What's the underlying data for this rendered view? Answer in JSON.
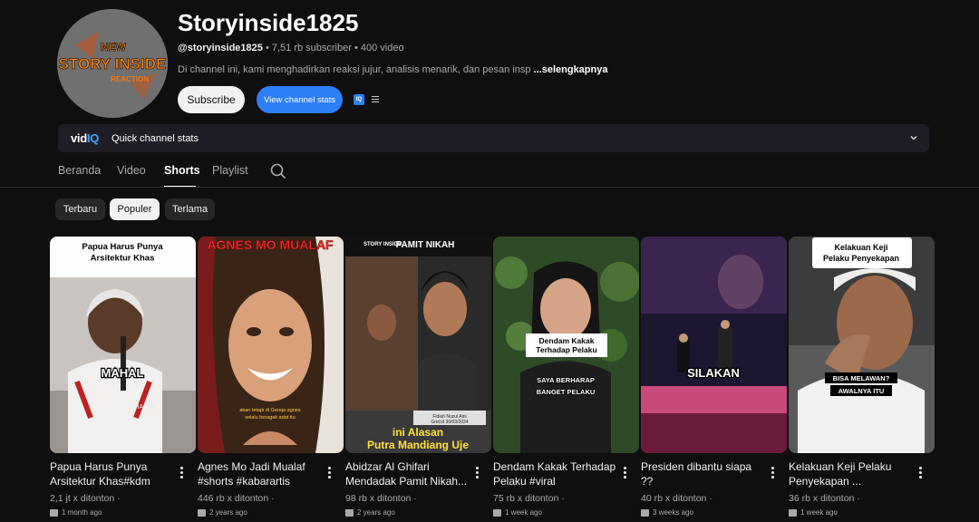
{
  "channel": {
    "title": "Storyinside1825",
    "handle": "@storyinside1825",
    "stats": "• 7,51 rb subscriber • 400 video",
    "description": "Di channel ini, kami menghadirkan reaksi jujur, analisis menarik, dan pesan insp",
    "more_label": "...selengkapnya",
    "avatar_text": [
      "NEW",
      "STORY INSIDE",
      "REACTION"
    ]
  },
  "buttons": {
    "subscribe": "Subscribe",
    "channel_stats": "View channel stats",
    "vidiq_badge": "IQ"
  },
  "vidiq_bar": {
    "logo_vid": "vid",
    "logo_iq": "IQ",
    "label": "Quick channel stats"
  },
  "tabs": [
    {
      "label": "Beranda"
    },
    {
      "label": "Video"
    },
    {
      "label": "Shorts"
    },
    {
      "label": "Playlist"
    }
  ],
  "active_tab": "Shorts",
  "chips": [
    {
      "label": "Terbaru"
    },
    {
      "label": "Populer"
    },
    {
      "label": "Terlama"
    }
  ],
  "active_chip": "Populer",
  "shorts": [
    {
      "title": "Papua Harus Punya Arsitektur Khas#kdm",
      "views": "2,1 jt x ditonton ·",
      "age": "1 month ago",
      "thumb_top_text": "Papua Harus Punya Arsitektur Khas",
      "thumb_overlay": "MAHAL",
      "thumb_watermark": "CHANNEL"
    },
    {
      "title": "Agnes Mo Jadi Mualaf #shorts #kabarartis",
      "views": "446 rb x ditonton ·",
      "age": "2 years ago",
      "thumb_top_text": "AGNES MO MUALAF",
      "thumb_caption": "akan tetapi di Gereja agnes selalu beragak adat itu"
    },
    {
      "title": "Abidzar Al Ghifari Mendadak Pamit Nikah...",
      "views": "98 rb x ditonton ·",
      "age": "2 years ago",
      "thumb_brand": "STORY INSIDE",
      "thumb_top_text": "PAMIT NIKAH",
      "thumb_caption": "ini Alasan Putra Mandiang Uje",
      "thumb_source": "Fidiah Nuzul Aini Grid.id 30/03/2024"
    },
    {
      "title": "Dendam Kakak Terhadap Pelaku #viral",
      "views": "75 rb x ditonton ·",
      "age": "1 week ago",
      "thumb_label": "Dendam Kakak Terhadap Pelaku",
      "thumb_caption_a": "SAYA BERHARAP",
      "thumb_caption_b": "BANGET PELAKU"
    },
    {
      "title": "Presiden dibantu siapa ??",
      "views": "40 rb x ditonton ·",
      "age": "3 weeks ago",
      "thumb_overlay": "SILAKAN"
    },
    {
      "title": "Kelakuan Keji Pelaku Penyekapan ...",
      "views": "36 rb x ditonton ·",
      "age": "1 week ago",
      "thumb_top_text": "Kelakuan Keji Pelaku Penyekapan",
      "thumb_caption_a": "BISA MELAWAN?",
      "thumb_caption_b": "AWALNYA ITU"
    }
  ],
  "colors": {
    "background": "#0f0f0f",
    "accent_blue": "#2d7ff9",
    "vidiq_bar": "#1e1f26"
  }
}
